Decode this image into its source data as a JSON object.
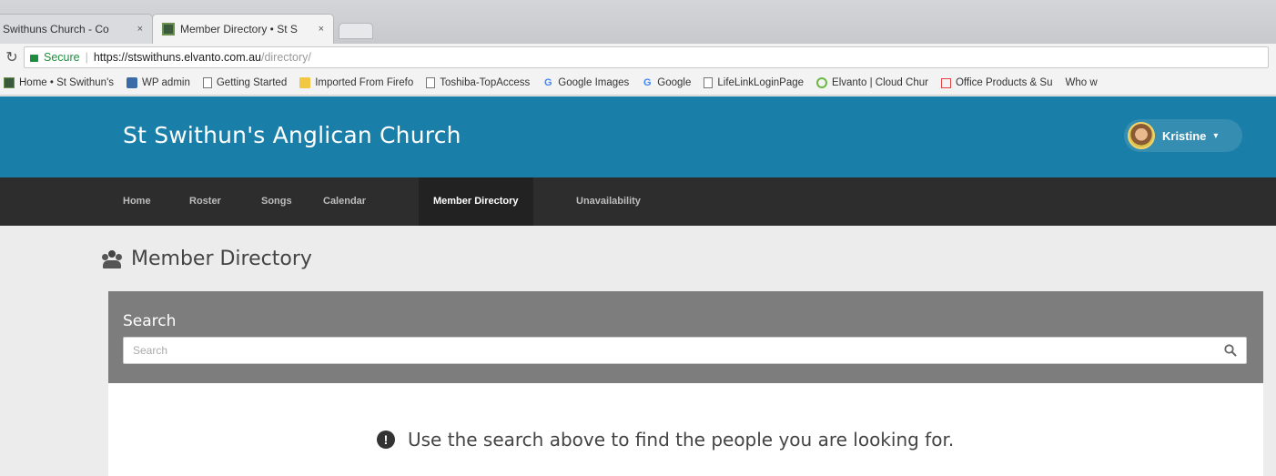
{
  "browser": {
    "tabs": [
      {
        "label": "Swithuns Church - Co",
        "close": "×"
      },
      {
        "label": "Member Directory • St S",
        "close": "×"
      }
    ],
    "reload_icon": "↻",
    "secure_label": "Secure",
    "url_base": "https://stswithuns.elvanto.com.au",
    "url_path": "/directory/",
    "bookmarks": [
      {
        "label": "Home • St Swithun's",
        "icon": "elvanto-icon"
      },
      {
        "label": "WP admin",
        "icon": "wordpress-icon"
      },
      {
        "label": "Getting Started",
        "icon": "page-icon"
      },
      {
        "label": "Imported From Firefo",
        "icon": "folder-icon"
      },
      {
        "label": "Toshiba-TopAccess",
        "icon": "page-icon"
      },
      {
        "label": "Google Images",
        "icon": "google-icon"
      },
      {
        "label": "Google",
        "icon": "google-icon"
      },
      {
        "label": "LifeLinkLoginPage",
        "icon": "page-icon"
      },
      {
        "label": "Elvanto | Cloud Chur",
        "icon": "elvanto-icon"
      },
      {
        "label": "Office Products & Su",
        "icon": "office-icon"
      },
      {
        "label": "Who w",
        "icon": ""
      }
    ]
  },
  "site": {
    "title": "St Swithun's Anglican Church",
    "user_name": "Kristine",
    "user_caret": "▾"
  },
  "nav": [
    {
      "label": "Home"
    },
    {
      "label": "Roster"
    },
    {
      "label": "Songs"
    },
    {
      "label": "Calendar"
    },
    {
      "label": "Member Directory",
      "active": true
    },
    {
      "label": "Unavailability"
    }
  ],
  "main": {
    "heading": "Member Directory",
    "search_label": "Search",
    "search_placeholder": "Search",
    "info_icon_glyph": "!",
    "info_message": "Use the search above to find the people you are looking for."
  },
  "colors": {
    "header_blue": "#1a7fa8",
    "nav_dark": "#2d2d2d",
    "search_panel_gray": "#7d7d7d"
  }
}
